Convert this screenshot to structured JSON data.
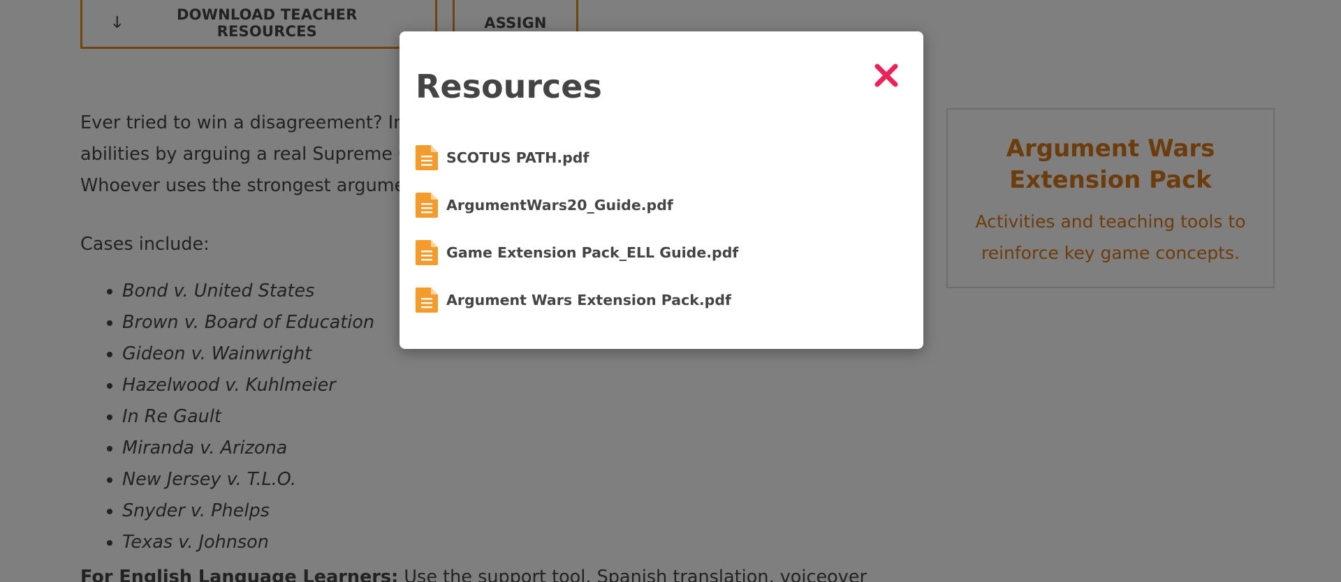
{
  "buttons": {
    "download_label": "DOWNLOAD TEACHER RESOURCES",
    "assign_label": "ASSIGN"
  },
  "intro": {
    "line1": "Ever tried to win a disagreement? In",
    "line2": "abilities by arguing a real Supreme C",
    "line3": "Whoever uses the strongest argume"
  },
  "cases": {
    "label": "Cases include:",
    "items": [
      "Bond v. United States",
      "Brown v. Board of Education",
      "Gideon v. Wainwright",
      "Hazelwood v. Kuhlmeier",
      "In Re Gault",
      "Miranda v. Arizona",
      "New Jersey v. T.L.O.",
      "Snyder v. Phelps",
      "Texas v. Johnson"
    ]
  },
  "ell": {
    "bold": "For English Language Learners:",
    "text": " Use the support tool. Spanish translation, voiceover"
  },
  "side_card": {
    "title": "Argument Wars Extension Pack",
    "description": "Activities and teaching tools to reinforce key game concepts."
  },
  "modal": {
    "title": "Resources",
    "files": [
      "SCOTUS PATH.pdf",
      "ArgumentWars20_Guide.pdf",
      "Game Extension Pack_ELL Guide.pdf",
      "Argument Wars Extension Pack.pdf"
    ]
  },
  "colors": {
    "accent_orange": "#e08c1e",
    "file_icon": "#f39c2b",
    "close_icon": "#e8245a",
    "text": "#444444"
  }
}
